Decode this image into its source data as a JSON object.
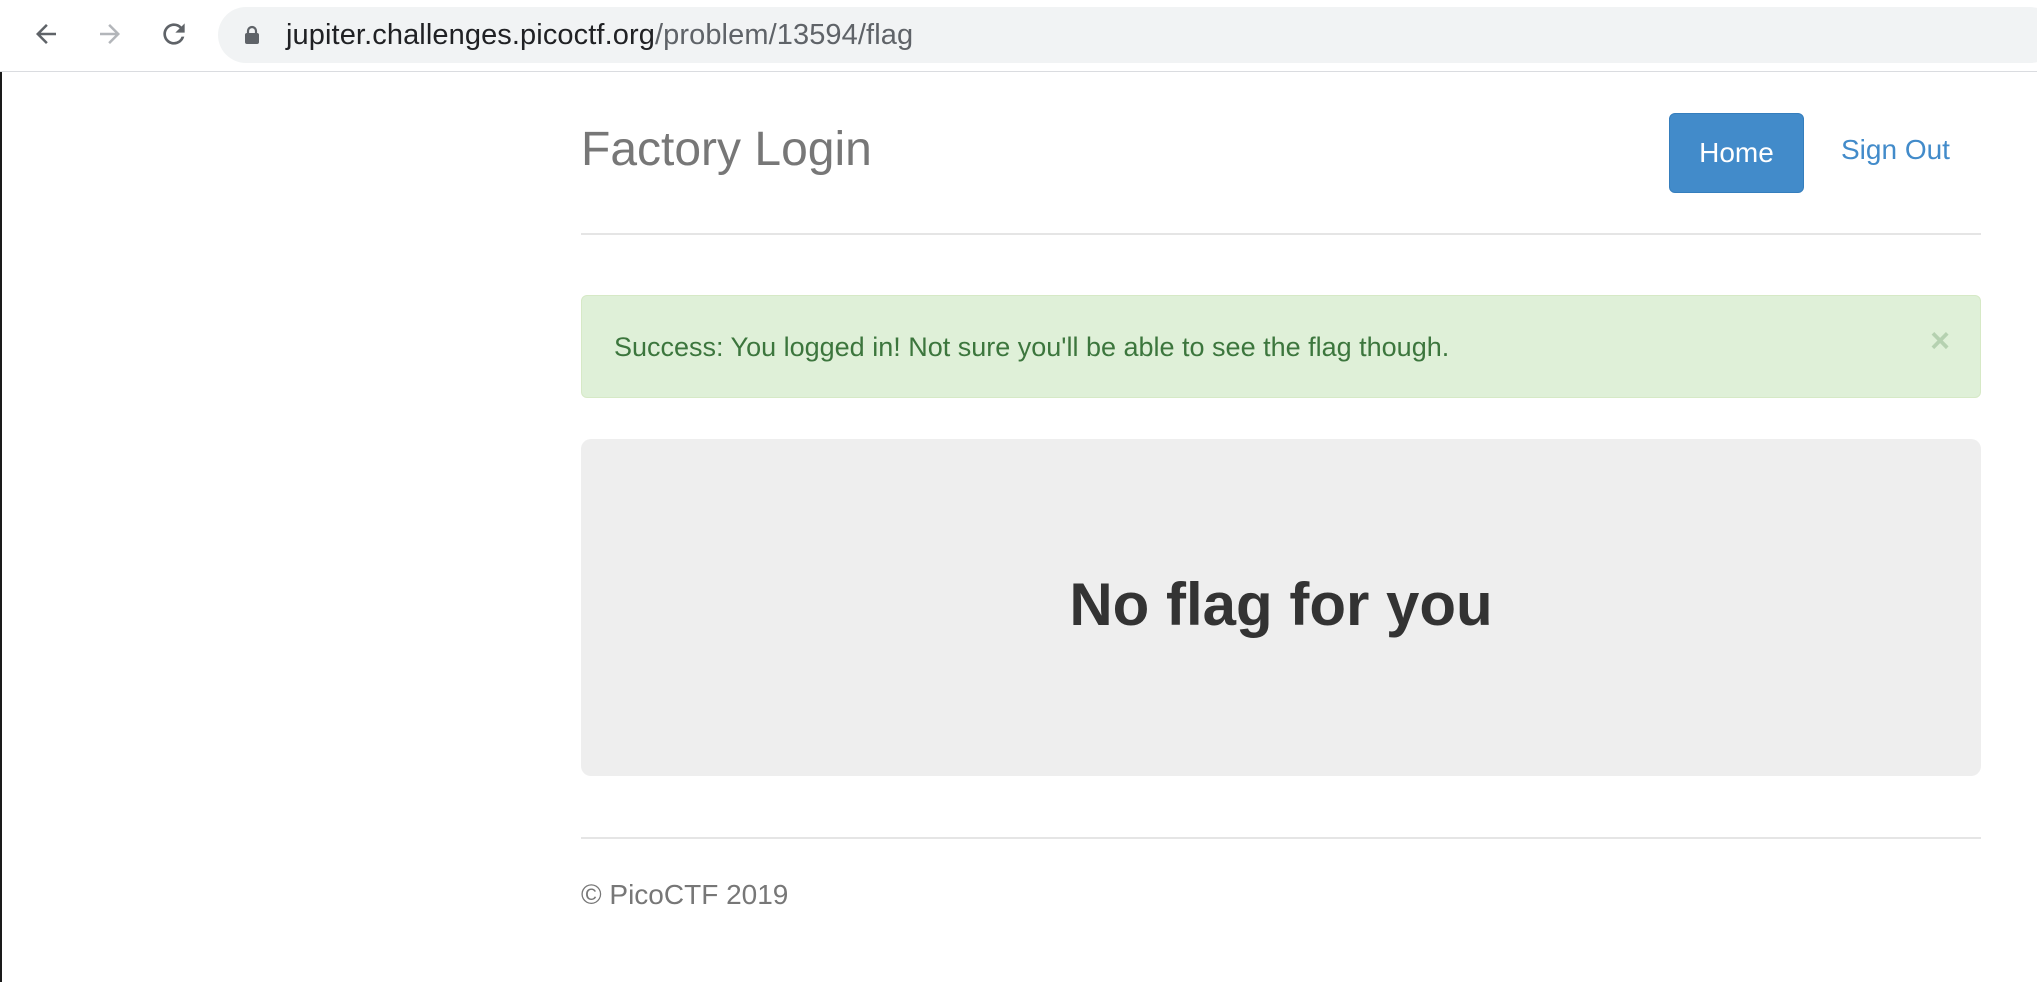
{
  "browser": {
    "url_host": "jupiter.challenges.picoctf.org",
    "url_path": "/problem/13594/flag",
    "icons": {
      "back": "arrow-left-icon",
      "forward": "arrow-right-icon",
      "reload": "reload-icon",
      "lock": "lock-icon"
    }
  },
  "header": {
    "brand": "Factory Login",
    "nav": {
      "home_label": "Home",
      "signout_label": "Sign Out"
    }
  },
  "alert": {
    "message": "Success: You logged in! Not sure you'll be able to see the flag though.",
    "close_symbol": "×"
  },
  "jumbotron": {
    "heading": "No flag for you"
  },
  "footer": {
    "text": "© PicoCTF 2019"
  },
  "colors": {
    "primary": "#428bca",
    "success_bg": "#dff0d8",
    "success_text": "#3c763d",
    "jumbotron_bg": "#eeeeee",
    "muted_text": "#777777"
  }
}
